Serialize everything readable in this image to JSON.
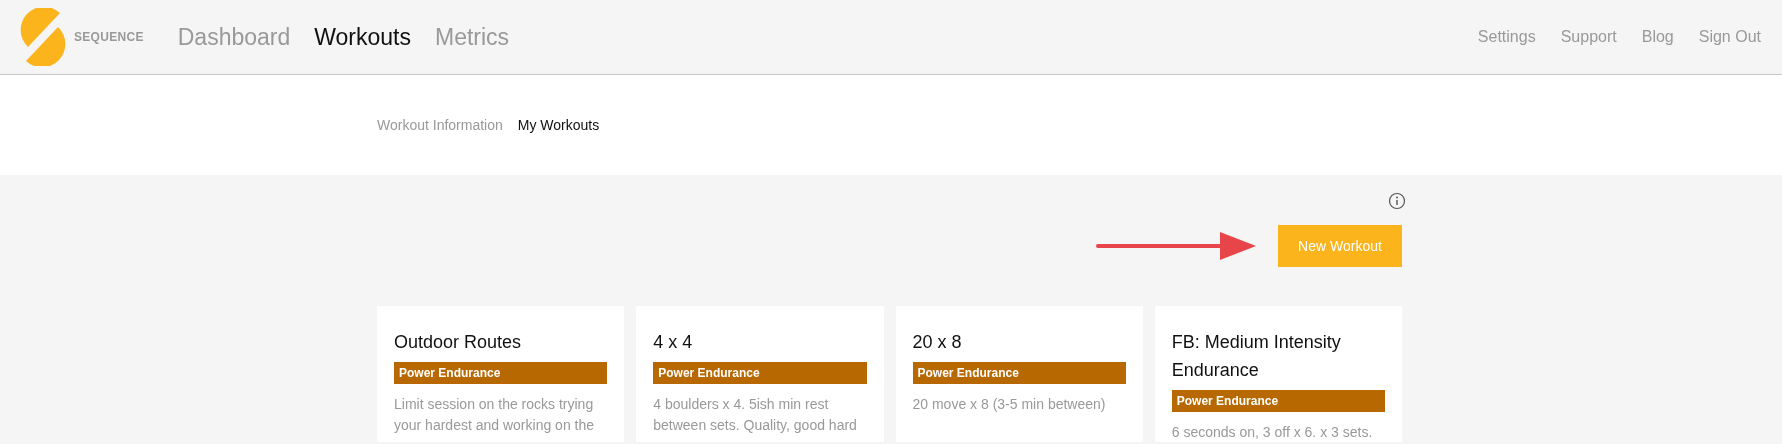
{
  "brand": {
    "name": "SEQUENCE"
  },
  "nav": [
    {
      "label": "Dashboard",
      "selected": false
    },
    {
      "label": "Workouts",
      "selected": true
    },
    {
      "label": "Metrics",
      "selected": false
    }
  ],
  "account_links": [
    "Settings",
    "Support",
    "Blog",
    "Sign Out"
  ],
  "subnav": [
    {
      "label": "Workout Information",
      "selected": false
    },
    {
      "label": "My Workouts",
      "selected": true
    }
  ],
  "new_workout_button": "New Workout",
  "workouts": [
    {
      "title": "Outdoor Routes",
      "tag": "Power Endurance",
      "description": "Limit session on the rocks trying your hardest and working on the"
    },
    {
      "title": "4 x 4",
      "tag": "Power Endurance",
      "description": "4 boulders x 4. 5ish min rest between sets. Quality, good hard"
    },
    {
      "title": "20 x 8",
      "tag": "Power Endurance",
      "description": "20 move x 8 (3-5 min between)"
    },
    {
      "title": "FB: Medium Intensity Endurance",
      "tag": "Power Endurance",
      "description": "6 seconds on, 3 off x 6. x 3 sets."
    }
  ]
}
